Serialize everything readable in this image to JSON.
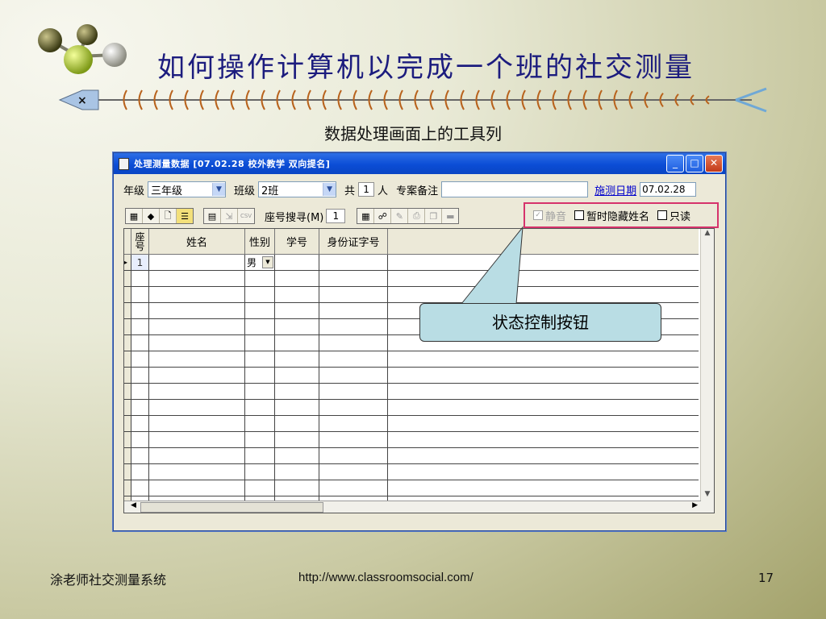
{
  "slide": {
    "title": "如何操作计算机以完成一个班的社交测量",
    "subtitle": "数据处理画面上的工具列",
    "footer_left": "涂老师社交测量系统",
    "footer_url": "http://www.classroomsocial.com/",
    "page_number": "17",
    "callout_text": "状态控制按钮",
    "fishbone_mark": "×"
  },
  "window": {
    "title": "处理测量数据 [07.02.28  校外教学  双向提名]",
    "buttons": {
      "minimize": "_",
      "maximize": "□",
      "close": "✕"
    }
  },
  "filters": {
    "grade_label": "年级",
    "grade_value": "三年级",
    "class_label": "班级",
    "class_value": "2班",
    "total_label": "共",
    "total_count": "1",
    "people_label": "人",
    "note_label": "专案备注",
    "note_value": "",
    "date_link": "施测日期",
    "date_value": "07.02.28"
  },
  "toolbar": {
    "seat_search_label": "座号搜寻(M)",
    "seat_search_value": "1",
    "csv_label": "CSV"
  },
  "status_controls": {
    "mute_label": "静音",
    "hide_names_label": "暂时隐藏姓名",
    "readonly_label": "只读",
    "mute_checked": true,
    "mute_enabled": false,
    "hide_names_checked": false,
    "readonly_checked": false
  },
  "grid": {
    "headers": {
      "seat": "座号",
      "name": "姓名",
      "gender": "性别",
      "student_id": "学号",
      "id_number": "身份证字号"
    },
    "rows": [
      {
        "seat": "1",
        "name": "",
        "gender": "男",
        "student_id": "",
        "id_number": ""
      }
    ],
    "indicator": "▸"
  },
  "colors": {
    "title": "#1c1c7e",
    "highlight_border": "#d6336b",
    "callout_fill": "#b9dde4",
    "window_frame": "#0b4dd6"
  }
}
